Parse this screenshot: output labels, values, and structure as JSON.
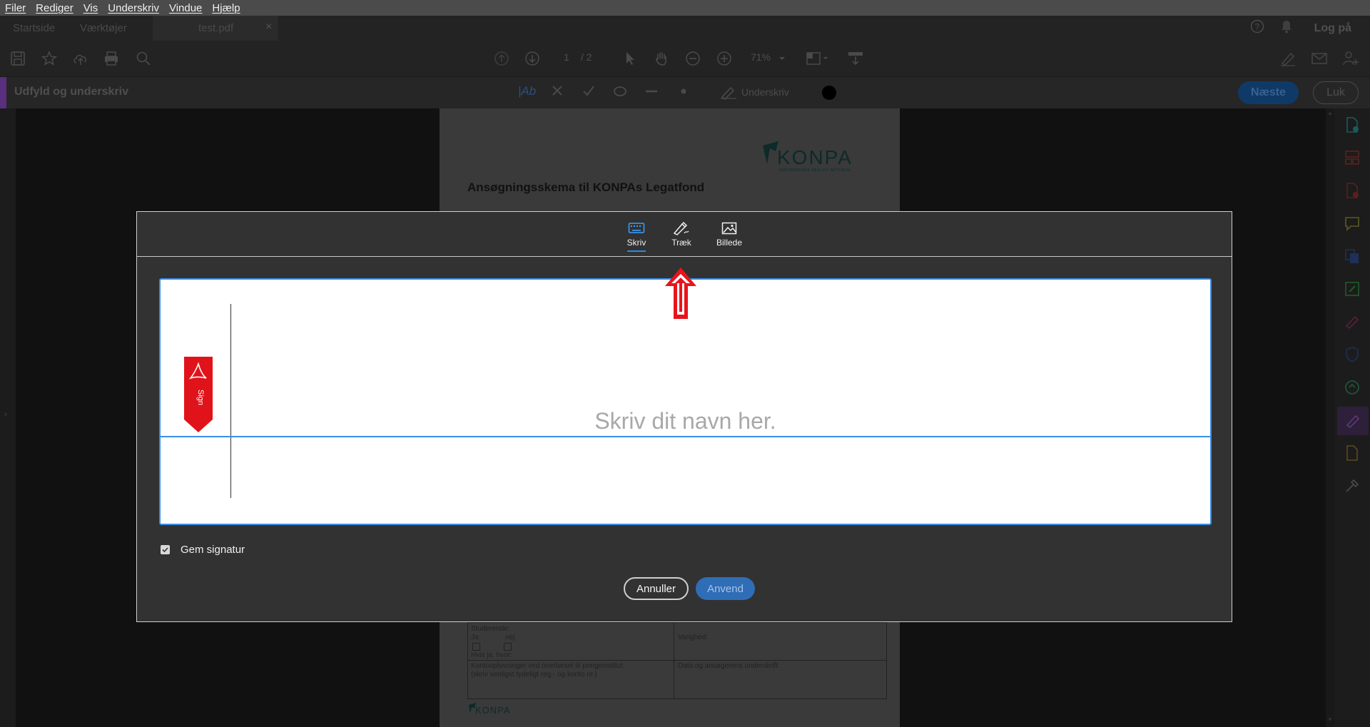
{
  "menu": [
    "Filer",
    "Rediger",
    "Vis",
    "Underskriv",
    "Vindue",
    "Hjælp"
  ],
  "tabs": {
    "home": "Startside",
    "tools": "Værktøjer",
    "document": "test.pdf",
    "close_glyph": "×"
  },
  "header_right": {
    "login": "Log på"
  },
  "toolbar": {
    "page_current": "1",
    "page_total": "/  2",
    "zoom": "71%"
  },
  "sign_bar": {
    "title": "Udfyld og underskriv",
    "text_tool": "|Ab",
    "signature_tool": "Underskriv",
    "next_button": "Næste",
    "close_button": "Luk",
    "accent_color": "#5a2f7f",
    "primary_color": "#1473e6"
  },
  "document": {
    "heading": "Ansøgningsskema til KONPAs Legatfond",
    "logo_text": "KONPA",
    "logo_tagline": "INSPIRERENDE FAGLIGT NETVÆRK",
    "form": {
      "student_label": "Studerende:",
      "yes": "Ja",
      "no": "nej",
      "if_yes": "Hvis ja, hvor:",
      "duration": "Varighed:",
      "account_label": "Kontooplysninger ved overførsel til pengeinstitut:",
      "account_hint": "(skriv venligst tydeligt reg.- og konto nr.)",
      "date_signature": "Dato og ansøgerens underskrift:"
    },
    "footer_logo": "KONPA"
  },
  "dialog": {
    "tabs": [
      {
        "label": "Skriv",
        "icon": "keyboard-icon",
        "active": true
      },
      {
        "label": "Træk",
        "icon": "pen-draw-icon",
        "active": false
      },
      {
        "label": "Billede",
        "icon": "image-icon",
        "active": false
      }
    ],
    "placeholder": "Skriv dit navn her.",
    "sign_flag": "Sign",
    "save_signature": "Gem signatur",
    "save_checked": true,
    "cancel": "Annuller",
    "apply": "Anvend"
  },
  "annotation": {
    "arrow_color": "#e8141c",
    "icon": "red-up-arrow-icon"
  }
}
